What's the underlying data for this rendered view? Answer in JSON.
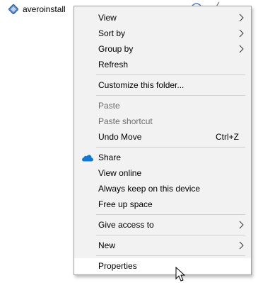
{
  "desktop": {
    "file_name": "averoinstall"
  },
  "menu": {
    "items": [
      {
        "label": "View"
      },
      {
        "label": "Sort by"
      },
      {
        "label": "Group by"
      },
      {
        "label": "Refresh"
      },
      {
        "label": "Customize this folder..."
      },
      {
        "label": "Paste"
      },
      {
        "label": "Paste shortcut"
      },
      {
        "label": "Undo Move",
        "shortcut": "Ctrl+Z"
      },
      {
        "label": "Share"
      },
      {
        "label": "View online"
      },
      {
        "label": "Always keep on this device"
      },
      {
        "label": "Free up space"
      },
      {
        "label": "Give access to"
      },
      {
        "label": "New"
      },
      {
        "label": "Properties"
      }
    ]
  },
  "colors": {
    "menu_bg": "#f2f2f2",
    "menu_border": "#a0a0a0",
    "disabled_text": "#6d6d6d",
    "onedrive_blue": "#0f78d4",
    "separator": "#cfcfcf"
  },
  "icons": {
    "file": "installer-icon",
    "share": "onedrive-cloud-icon",
    "submenu": "chevron-right-icon"
  }
}
